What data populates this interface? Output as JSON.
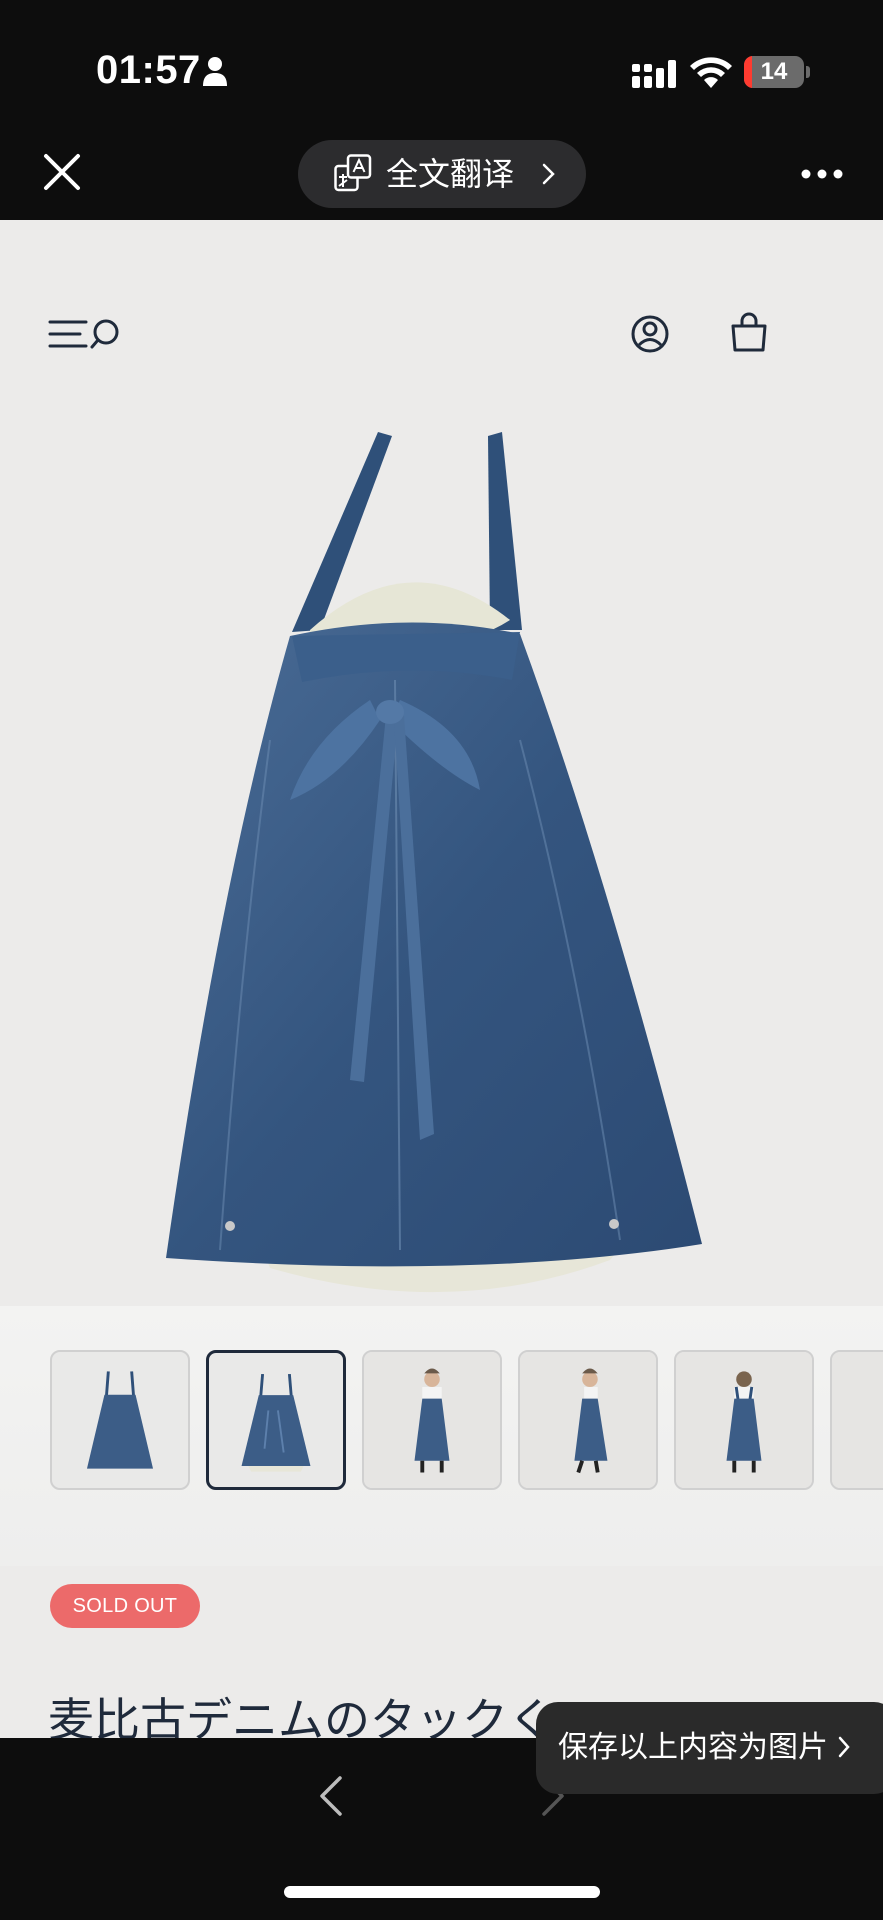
{
  "status_bar": {
    "time": "01:57",
    "battery_level": "14",
    "battery_fraction": 0.14,
    "icons": [
      "person-icon",
      "signal-icon",
      "wifi-icon",
      "battery-icon"
    ]
  },
  "top_bar": {
    "translate_label": "全文翻译",
    "icons": [
      "close-icon",
      "translate-icon",
      "chevron-right-icon",
      "more-icon"
    ]
  },
  "site_header": {
    "icons": [
      "menu-icon",
      "search-icon",
      "account-icon",
      "cart-icon"
    ]
  },
  "product": {
    "badge": "SOLD OUT",
    "title": "麦比古デニムのタックく",
    "thumbnails": [
      {
        "type": "flat-front"
      },
      {
        "type": "flat-back",
        "selected": true
      },
      {
        "type": "model-front"
      },
      {
        "type": "model-side"
      },
      {
        "type": "model-back"
      },
      {
        "type": "partial"
      }
    ]
  },
  "toast": {
    "save_label": "保存以上内容为图片"
  },
  "bottom_bar": {
    "icons": [
      "back-icon",
      "forward-icon"
    ]
  },
  "colors": {
    "background_dark": "#0d0d0d",
    "page_bg": "#ecebea",
    "navy": "#1f2a3b",
    "sold_out": "#ec6a6a",
    "denim": "#3c5d87",
    "battery_low": "#ff3b30"
  }
}
